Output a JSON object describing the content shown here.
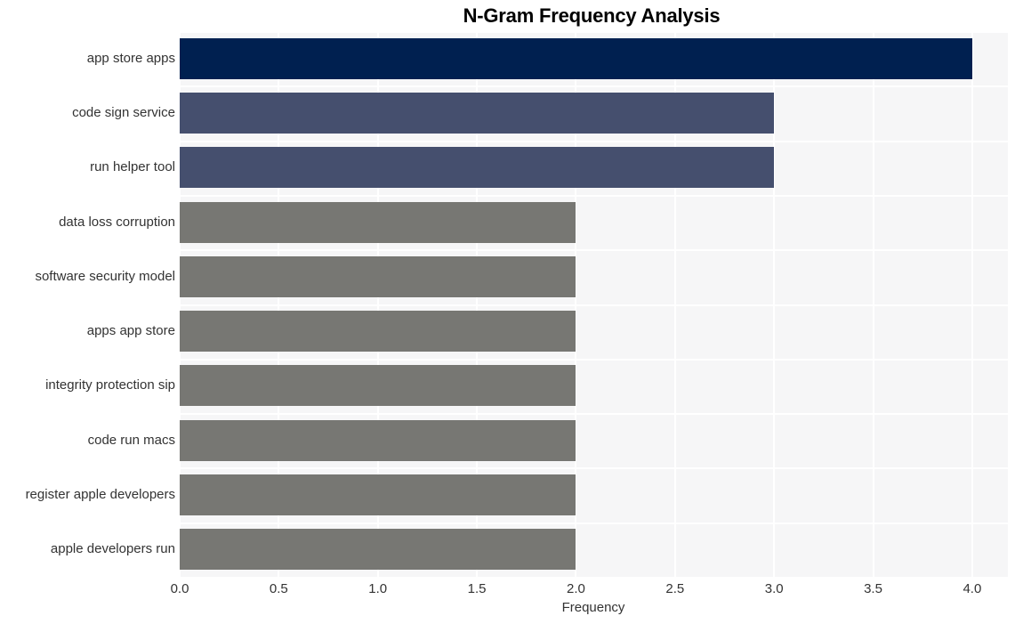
{
  "chart_data": {
    "type": "bar",
    "orientation": "horizontal",
    "title": "N-Gram Frequency Analysis",
    "xlabel": "Frequency",
    "ylabel": "",
    "xlim": [
      0.0,
      4.18
    ],
    "xticks": [
      "0.0",
      "0.5",
      "1.0",
      "1.5",
      "2.0",
      "2.5",
      "3.0",
      "3.5",
      "4.0"
    ],
    "xtick_values": [
      0.0,
      0.5,
      1.0,
      1.5,
      2.0,
      2.5,
      3.0,
      3.5,
      4.0
    ],
    "grid": true,
    "legend": null,
    "categories": [
      "app store apps",
      "code sign service",
      "run helper tool",
      "data loss corruption",
      "software security model",
      "apps app store",
      "integrity protection sip",
      "code run macs",
      "register apple developers",
      "apple developers run"
    ],
    "values": [
      4,
      3,
      3,
      2,
      2,
      2,
      2,
      2,
      2,
      2
    ],
    "bar_colors": [
      "#002050",
      "#454f6e",
      "#454f6e",
      "#777773",
      "#777773",
      "#777773",
      "#777773",
      "#777773",
      "#777773",
      "#777773"
    ]
  },
  "style": {
    "plot_background": "#f6f6f7",
    "figure_background": "#ffffff",
    "grid_color": "#ffffff",
    "tick_label_color": "#333333",
    "title_color": "#000000"
  }
}
